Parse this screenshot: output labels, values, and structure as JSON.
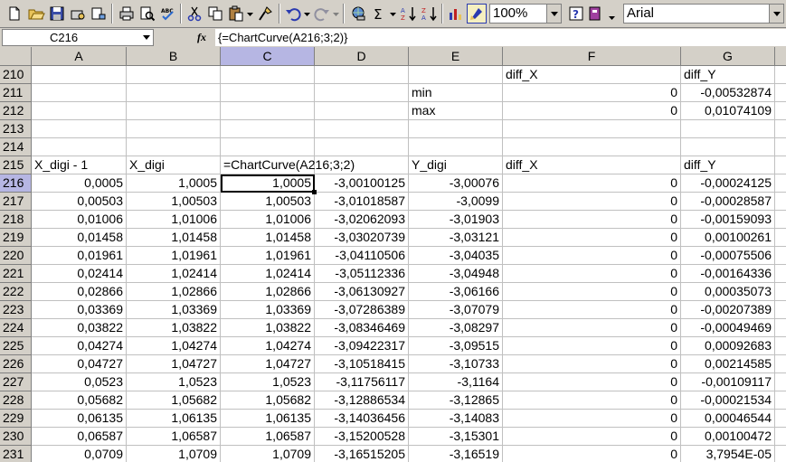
{
  "toolbar": {
    "zoom": "100%",
    "font": "Arial",
    "icons": [
      "new-icon",
      "open-icon",
      "save-icon",
      "permission-icon",
      "email-icon",
      "print-icon",
      "print-preview-icon",
      "spelling-icon",
      "cut-icon",
      "copy-icon",
      "paste-icon",
      "format-painter-icon",
      "undo-icon",
      "redo-icon",
      "hyperlink-icon",
      "autosum-icon",
      "sort-ascending-icon",
      "sort-descending-icon",
      "chart-wizard-icon",
      "drawing-icon",
      "help-icon",
      "research-icon"
    ]
  },
  "formula_bar": {
    "name_box": "C216",
    "fx": "fx",
    "formula": "{=ChartCurve(A216;3;2)}"
  },
  "columns": [
    "A",
    "B",
    "C",
    "D",
    "E",
    "F",
    "G"
  ],
  "rows": [
    {
      "num": "210",
      "cells": [
        "",
        "",
        "",
        "",
        "",
        "diff_X",
        "diff_Y"
      ]
    },
    {
      "num": "211",
      "cells": [
        "",
        "",
        "",
        "",
        "min",
        "0",
        "-0,00532874"
      ]
    },
    {
      "num": "212",
      "cells": [
        "",
        "",
        "",
        "",
        "max",
        "0",
        "0,01074109"
      ]
    },
    {
      "num": "213",
      "cells": [
        "",
        "",
        "",
        "",
        "",
        "",
        ""
      ]
    },
    {
      "num": "214",
      "cells": [
        "",
        "",
        "",
        "",
        "",
        "",
        ""
      ]
    },
    {
      "num": "215",
      "cells": [
        "X_digi - 1",
        "X_digi",
        "=ChartCurve(A216;3;2)",
        "",
        "Y_digi",
        "diff_X",
        "diff_Y"
      ]
    },
    {
      "num": "216",
      "cells": [
        "0,0005",
        "1,0005",
        "1,0005",
        "-3,00100125",
        "-3,00076",
        "0",
        "-0,00024125"
      ]
    },
    {
      "num": "217",
      "cells": [
        "0,00503",
        "1,00503",
        "1,00503",
        "-3,01018587",
        "-3,0099",
        "0",
        "-0,00028587"
      ]
    },
    {
      "num": "218",
      "cells": [
        "0,01006",
        "1,01006",
        "1,01006",
        "-3,02062093",
        "-3,01903",
        "0",
        "-0,00159093"
      ]
    },
    {
      "num": "219",
      "cells": [
        "0,01458",
        "1,01458",
        "1,01458",
        "-3,03020739",
        "-3,03121",
        "0",
        "0,00100261"
      ]
    },
    {
      "num": "220",
      "cells": [
        "0,01961",
        "1,01961",
        "1,01961",
        "-3,04110506",
        "-3,04035",
        "0",
        "-0,00075506"
      ]
    },
    {
      "num": "221",
      "cells": [
        "0,02414",
        "1,02414",
        "1,02414",
        "-3,05112336",
        "-3,04948",
        "0",
        "-0,00164336"
      ]
    },
    {
      "num": "222",
      "cells": [
        "0,02866",
        "1,02866",
        "1,02866",
        "-3,06130927",
        "-3,06166",
        "0",
        "0,00035073"
      ]
    },
    {
      "num": "223",
      "cells": [
        "0,03369",
        "1,03369",
        "1,03369",
        "-3,07286389",
        "-3,07079",
        "0",
        "-0,00207389"
      ]
    },
    {
      "num": "224",
      "cells": [
        "0,03822",
        "1,03822",
        "1,03822",
        "-3,08346469",
        "-3,08297",
        "0",
        "-0,00049469"
      ]
    },
    {
      "num": "225",
      "cells": [
        "0,04274",
        "1,04274",
        "1,04274",
        "-3,09422317",
        "-3,09515",
        "0",
        "0,00092683"
      ]
    },
    {
      "num": "226",
      "cells": [
        "0,04727",
        "1,04727",
        "1,04727",
        "-3,10518415",
        "-3,10733",
        "0",
        "0,00214585"
      ]
    },
    {
      "num": "227",
      "cells": [
        "0,0523",
        "1,0523",
        "1,0523",
        "-3,11756117",
        "-3,1164",
        "0",
        "-0,00109117"
      ]
    },
    {
      "num": "228",
      "cells": [
        "0,05682",
        "1,05682",
        "1,05682",
        "-3,12886534",
        "-3,12865",
        "0",
        "-0,00021534"
      ]
    },
    {
      "num": "229",
      "cells": [
        "0,06135",
        "1,06135",
        "1,06135",
        "-3,14036456",
        "-3,14083",
        "0",
        "0,00046544"
      ]
    },
    {
      "num": "230",
      "cells": [
        "0,06587",
        "1,06587",
        "1,06587",
        "-3,15200528",
        "-3,15301",
        "0",
        "0,00100472"
      ]
    },
    {
      "num": "231",
      "cells": [
        "0,0709",
        "1,0709",
        "1,0709",
        "-3,16515205",
        "-3,16519",
        "0",
        "3,7954E-05"
      ]
    }
  ],
  "selection": {
    "row": "216",
    "column": "C"
  }
}
